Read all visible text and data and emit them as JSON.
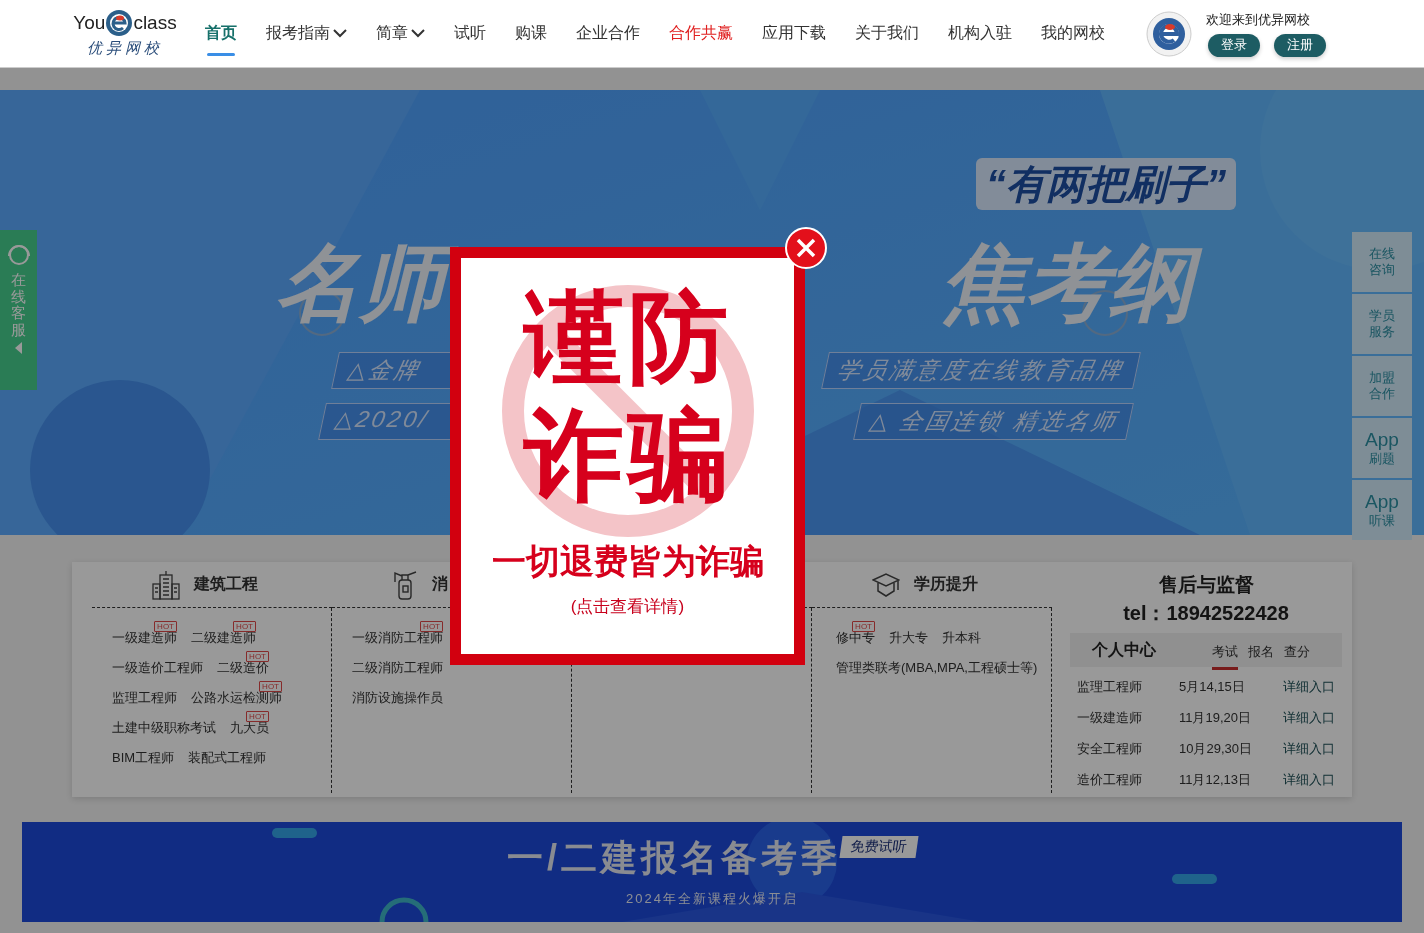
{
  "header": {
    "logo": {
      "left": "You",
      "right": "class",
      "subtitle": "优异网校"
    },
    "nav": [
      {
        "label": "首页",
        "selected": true,
        "kind": "link"
      },
      {
        "label": "报考指南",
        "selected": false,
        "kind": "dropdown"
      },
      {
        "label": "简章",
        "selected": false,
        "kind": "dropdown"
      },
      {
        "label": "试听",
        "selected": false,
        "kind": "link"
      },
      {
        "label": "购课",
        "selected": false,
        "kind": "link"
      },
      {
        "label": "企业合作",
        "selected": false,
        "kind": "link"
      },
      {
        "label": "合作共赢",
        "selected": false,
        "kind": "promo"
      },
      {
        "label": "应用下载",
        "selected": false,
        "kind": "link"
      },
      {
        "label": "关于我们",
        "selected": false,
        "kind": "link"
      },
      {
        "label": "机构入驻",
        "selected": false,
        "kind": "link"
      },
      {
        "label": "我的网校",
        "selected": false,
        "kind": "link"
      }
    ],
    "user": {
      "welcome": "欢迎来到优异网校",
      "buttons": [
        "登录",
        "注册"
      ]
    }
  },
  "hero": {
    "quote": "“有两把刷子”",
    "title_left": "名师",
    "title_right": "焦考纲",
    "taglines": [
      {
        "left": "△金牌",
        "right": "学员满意度在线教育品牌"
      },
      {
        "left": "△2020/",
        "right": "△ 全国连锁 精选名师"
      }
    ]
  },
  "left_tab": {
    "label": "在线客服"
  },
  "right_tabs": [
    {
      "kind": "text",
      "top": "在线",
      "bottom": "咨询"
    },
    {
      "kind": "text",
      "top": "学员",
      "bottom": "服务"
    },
    {
      "kind": "text",
      "top": "加盟",
      "bottom": "合作"
    },
    {
      "kind": "app",
      "top": "App",
      "bottom": "刷题"
    },
    {
      "kind": "app",
      "top": "App",
      "bottom": "听课"
    }
  ],
  "categories": [
    {
      "title": "建筑工程",
      "kind": "building",
      "rows": [
        [
          {
            "label": "一级建造师",
            "badge": "HOT"
          },
          {
            "label": "二级建造师",
            "badge": "HOT"
          }
        ],
        [
          {
            "label": "一级造价工程师"
          },
          {
            "label": "二级造价",
            "badge": "HOT"
          }
        ],
        [
          {
            "label": "监理工程师"
          },
          {
            "label": "公路水运检测师",
            "badge": "HOT"
          }
        ],
        [
          {
            "label": "土建中级职称考试"
          },
          {
            "label": "九大员",
            "badge": "HOT"
          }
        ],
        [
          {
            "label": "BIM工程师"
          },
          {
            "label": "装配式工程师"
          }
        ]
      ]
    },
    {
      "title": "消",
      "kind": "extinguisher",
      "rows": [
        [
          {
            "label": "一级消防工程师",
            "badge": "HOT"
          }
        ],
        [
          {
            "label": "二级消防工程师"
          }
        ],
        [
          {
            "label": "消防设施操作员"
          }
        ]
      ]
    },
    {
      "kind": "covered"
    },
    {
      "title": "学历提升",
      "kind": "cap",
      "rows": [
        [
          {
            "label": "修中专",
            "badge": "HOT"
          },
          {
            "label": "升大专"
          },
          {
            "label": "升本科"
          }
        ],
        [
          {
            "label": "管理类联考(MBA,MPA,工程硕士等)"
          }
        ]
      ]
    }
  ],
  "support": {
    "title": "售后与监督",
    "tel": "tel：18942522428",
    "center": "个人中心",
    "tabs": [
      {
        "label": "考试",
        "selected": true
      },
      {
        "label": "报名",
        "selected": false
      },
      {
        "label": "查分",
        "selected": false
      }
    ],
    "rows": [
      [
        "监理工程师",
        "5月14,15日",
        "详细入口"
      ],
      [
        "一级建造师",
        "11月19,20日",
        "详细入口"
      ],
      [
        "安全工程师",
        "10月29,30日",
        "详细入口"
      ],
      [
        "造价工程师",
        "11月12,13日",
        "详细入口"
      ]
    ]
  },
  "promo_banner": {
    "title": "一/二建报名备考季",
    "badge": "免费试听",
    "subtitle": "2024年全新课程火爆开启"
  },
  "modal": {
    "warning_top": "谨防",
    "warning_bottom": "诈骗",
    "slogan": "一切退费皆为诈骗",
    "link": "(点击查看详情)"
  }
}
